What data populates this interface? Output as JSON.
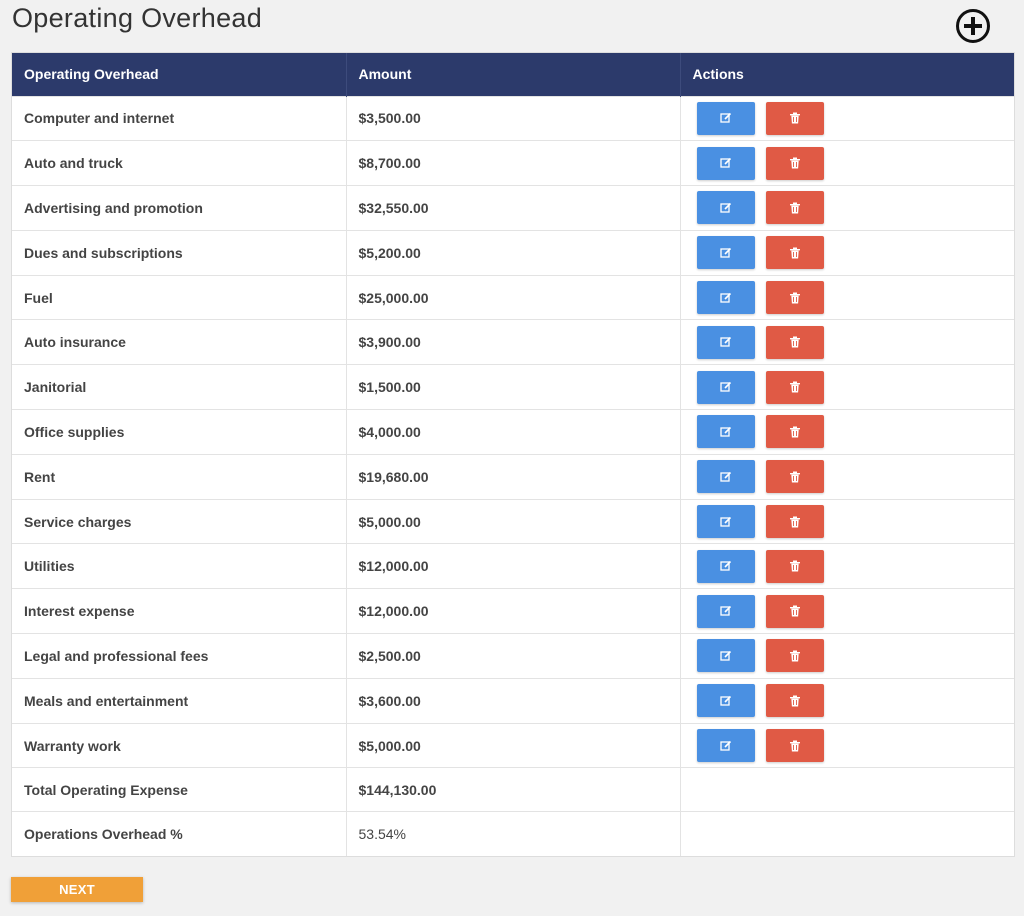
{
  "page": {
    "title": "Operating Overhead",
    "add_icon": "plus-circle-icon"
  },
  "table": {
    "headers": [
      "Operating Overhead",
      "Amount",
      "Actions"
    ],
    "rows": [
      {
        "name": "Computer and internet",
        "amount": "$3,500.00"
      },
      {
        "name": "Auto and truck",
        "amount": "$8,700.00"
      },
      {
        "name": "Advertising and promotion",
        "amount": "$32,550.00"
      },
      {
        "name": "Dues and subscriptions",
        "amount": "$5,200.00"
      },
      {
        "name": "Fuel",
        "amount": "$25,000.00"
      },
      {
        "name": "Auto insurance",
        "amount": "$3,900.00"
      },
      {
        "name": "Janitorial",
        "amount": "$1,500.00"
      },
      {
        "name": "Office supplies",
        "amount": "$4,000.00"
      },
      {
        "name": "Rent",
        "amount": "$19,680.00"
      },
      {
        "name": "Service charges",
        "amount": "$5,000.00"
      },
      {
        "name": "Utilities",
        "amount": "$12,000.00"
      },
      {
        "name": "Interest expense",
        "amount": "$12,000.00"
      },
      {
        "name": "Legal and professional fees",
        "amount": "$2,500.00"
      },
      {
        "name": "Meals and entertainment",
        "amount": "$3,600.00"
      },
      {
        "name": "Warranty work",
        "amount": "$5,000.00"
      }
    ],
    "edit_icon": "edit-icon",
    "delete_icon": "trash-icon",
    "summary": {
      "total_label": "Total Operating Expense",
      "total_value": "$144,130.00",
      "percent_label": "Operations Overhead %",
      "percent_value": "53.54%"
    }
  },
  "footer": {
    "next_label": "NEXT"
  },
  "colors": {
    "header_bg": "#2c3a6b",
    "edit_button": "#4a90e2",
    "delete_button": "#e05a45",
    "next_button": "#f0a038"
  }
}
